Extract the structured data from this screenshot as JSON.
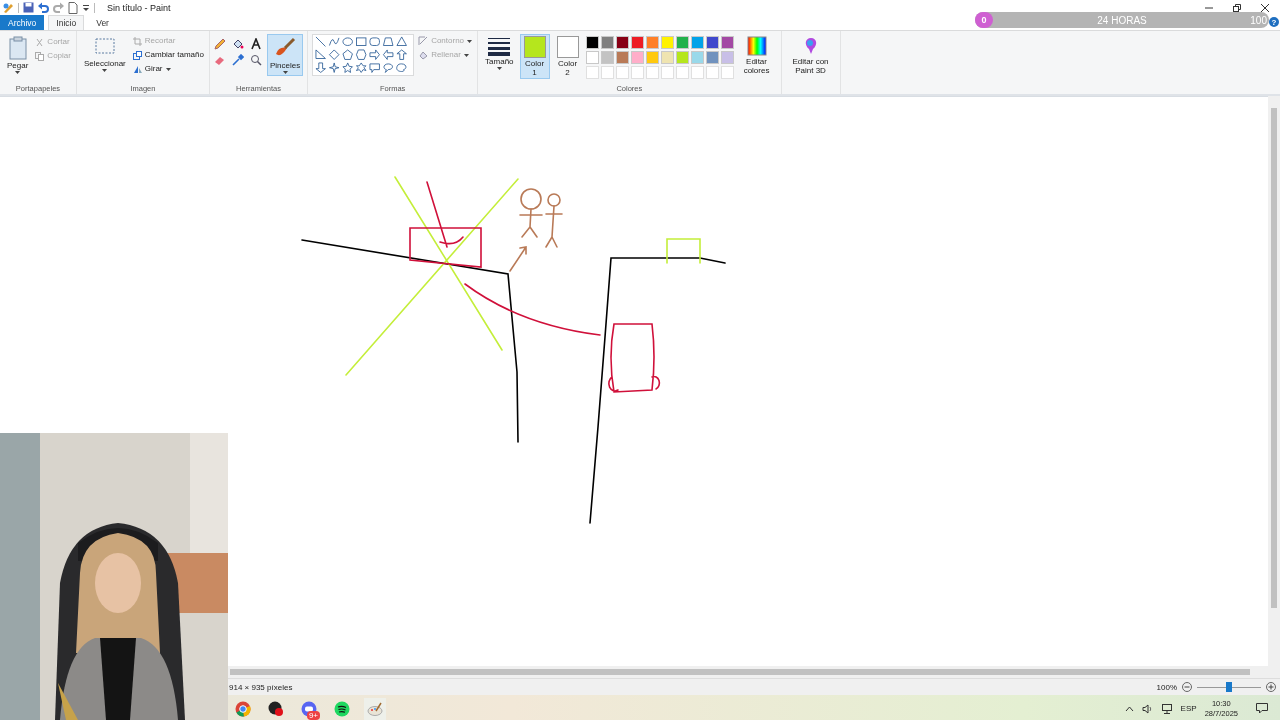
{
  "title_bar": {
    "title": "Sin título - Paint"
  },
  "timer_overlay": {
    "start": "0",
    "label": "24 HORAS",
    "end": "100",
    "help": "?",
    "level": 0
  },
  "tabs": [
    {
      "label": "Archivo",
      "selected": false,
      "kind": "file"
    },
    {
      "label": "Inicio",
      "selected": true,
      "kind": "tab"
    },
    {
      "label": "Ver",
      "selected": false,
      "kind": "tab"
    }
  ],
  "clipboard": {
    "paste": "Pegar",
    "cut": {
      "label": "Cortar",
      "disabled": true
    },
    "copy": {
      "label": "Copiar",
      "disabled": true
    },
    "group_label": "Portapapeles"
  },
  "image": {
    "select": "Seleccionar",
    "crop": {
      "label": "Recortar",
      "disabled": true
    },
    "resize": {
      "label": "Cambiar tamaño",
      "disabled": false
    },
    "rotate": {
      "label": "Girar",
      "disabled": false
    },
    "group_label": "Imagen"
  },
  "tools": {
    "brushes": {
      "label": "Pinceles",
      "selected": true
    },
    "group_label": "Herramientas"
  },
  "shapes": {
    "outline": {
      "label": "Contorno",
      "disabled": true
    },
    "fill": {
      "label": "Rellenar",
      "disabled": true
    },
    "group_label": "Formas"
  },
  "size": {
    "label": "Tamaño"
  },
  "colors": {
    "color1": {
      "label": "Color 1",
      "color": "#b5e61d",
      "selected": true
    },
    "color2": {
      "label": "Color 2",
      "color": "#ffffff",
      "selected": false
    },
    "palette": [
      {
        "color": "#000000"
      },
      {
        "color": "#7f7f7f"
      },
      {
        "color": "#880015"
      },
      {
        "color": "#ed1c24"
      },
      {
        "color": "#ff7f27"
      },
      {
        "color": "#fff200"
      },
      {
        "color": "#22b14c"
      },
      {
        "color": "#00a2e8"
      },
      {
        "color": "#3f48cc"
      },
      {
        "color": "#a349a4"
      },
      {
        "color": "#ffffff"
      },
      {
        "color": "#c3c3c3"
      },
      {
        "color": "#b97a57"
      },
      {
        "color": "#ffaec9"
      },
      {
        "color": "#ffc90e"
      },
      {
        "color": "#efe4b0"
      },
      {
        "color": "#b5e61d"
      },
      {
        "color": "#99d9ea"
      },
      {
        "color": "#7092be"
      },
      {
        "color": "#c8bfe7"
      }
    ],
    "edit_colors": "Editar colores",
    "group_label": "Colores"
  },
  "paint3d": "Editar con Paint 3D",
  "status_bar": {
    "dimensions": "914 × 935 píxeles",
    "zoom": "100%",
    "zoom_slider": {
      "level": 0.5
    }
  },
  "taskbar": {
    "badge": "9+",
    "language": "ESP",
    "time": "10:30",
    "date": "28/7/2025"
  }
}
